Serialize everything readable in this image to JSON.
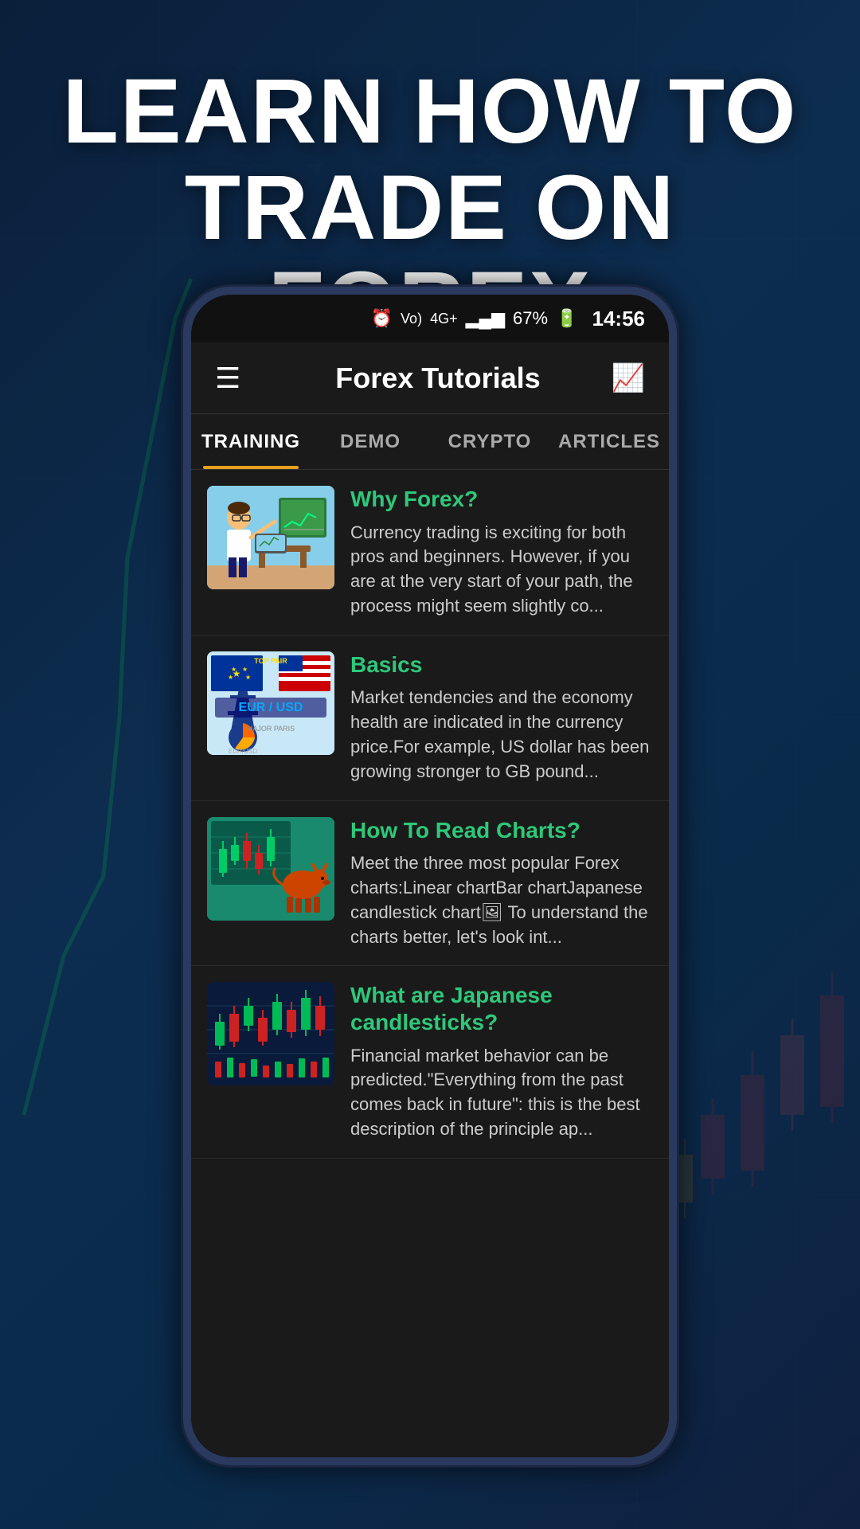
{
  "page": {
    "header": {
      "line1": "LEARN HOW TO",
      "line2": "TRADE ON FOREX"
    },
    "status_bar": {
      "time": "14:56",
      "battery": "67%",
      "signal": "4G+"
    },
    "app_bar": {
      "title": "Forex Tutorials"
    },
    "tabs": [
      {
        "label": "TRAINING",
        "active": true
      },
      {
        "label": "DEMO",
        "active": false
      },
      {
        "label": "CRYPTO",
        "active": false
      },
      {
        "label": "ARTICLES",
        "active": false
      }
    ],
    "articles": [
      {
        "id": "why-forex",
        "title": "Why Forex?",
        "excerpt": "Currency trading is exciting for both pros and beginners. However, if you are at the very start of your path, the process might seem slightly co..."
      },
      {
        "id": "basics",
        "title": "Basics",
        "excerpt": "Market tendencies and the economy health are indicated in the currency price.For example, US dollar has been growing stronger to GB pound..."
      },
      {
        "id": "how-to-read-charts",
        "title": "How To Read Charts?",
        "excerpt": "Meet the three most popular Forex charts:Linear chartBar chartJapanese candlestick chart🖼 To understand the charts better, let's look int..."
      },
      {
        "id": "japanese-candlesticks",
        "title": "What are Japanese candlesticks?",
        "excerpt": "Financial market behavior can be predicted.\"Everything from the past comes back in future\": this is the best description of the principle ap..."
      }
    ]
  }
}
